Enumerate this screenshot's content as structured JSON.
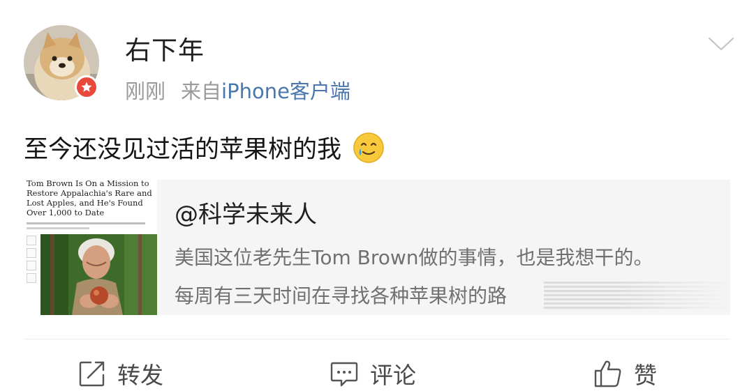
{
  "post": {
    "author": "右下年",
    "time": "刚刚",
    "source_prefix": "来自",
    "source": "iPhone客户端",
    "text": "至今还没见过活的苹果树的我",
    "emoji": "smiling-face-with-tear"
  },
  "repost_card": {
    "thumbnail": {
      "headline": "Tom Brown Is On a Mission to Restore Appalachia's Rare and Lost Apples, and He's Found Over 1,000 to Date"
    },
    "author": "@科学未来人",
    "line1": "美国这位老先生Tom Brown做的事情，也是我想干的。",
    "line2": "每周有三天时间在寻找各种苹果树的路"
  },
  "actions": {
    "repost": "转发",
    "comment": "评论",
    "like": "赞"
  },
  "icons": {
    "menu": "chevron-down-icon",
    "badge": "vip-star-icon",
    "repost": "repost-icon",
    "comment": "comment-icon",
    "like": "thumbs-up-icon"
  },
  "colors": {
    "source_link": "#4a77ad",
    "badge": "#e8493d",
    "meta_text": "#9a9a9a",
    "card_bg": "#f5f5f5"
  }
}
